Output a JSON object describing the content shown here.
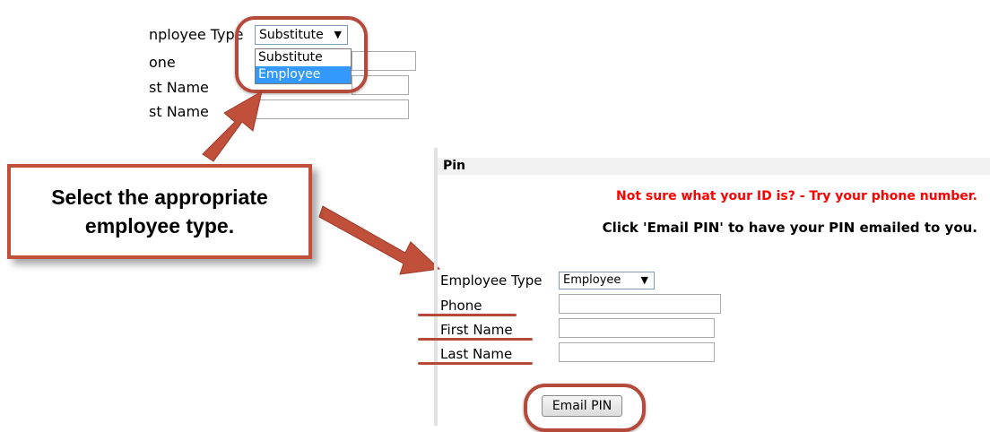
{
  "top_form": {
    "employee_type_label": "nployee Type",
    "phone_label": "one",
    "first_name_label": "st Name",
    "last_name_label": "st Name",
    "select_value": "Substitute",
    "select_arrow": "▼",
    "dropdown_options": [
      "Substitute",
      "Employee"
    ]
  },
  "callout": {
    "text": "Select the appropriate employee type."
  },
  "pin_form": {
    "section_title": "Pin",
    "hint_red": "Not sure what your ID is? - Try your phone number.",
    "hint_black": "Click 'Email PIN' to have your PIN emailed to you.",
    "employee_type_label": "Employee Type",
    "select_value": "Employee",
    "select_arrow": "▼",
    "phone_label": "Phone",
    "first_name_label": "First Name",
    "last_name_label": "Last Name",
    "email_pin_button": "Email PIN"
  },
  "colors": {
    "annotation": "#b5493a",
    "warning_text": "#ff0000",
    "selected_option": "#3399ff"
  }
}
